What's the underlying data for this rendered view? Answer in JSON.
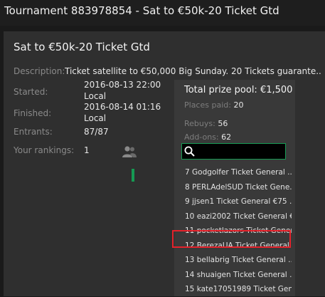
{
  "window": {
    "title": "Tournament 883978854 - Sat to €50k-20 Ticket Gtd"
  },
  "panel": {
    "title": "Sat to €50k-20 Ticket Gtd",
    "description_label": "Description:",
    "description_value": "Ticket satellite to €50,000 Big Sunday. 20 Tickets guarante...",
    "started_label": "Started:",
    "started_value_1": "2016-08-13 22:00",
    "started_value_2": "Local",
    "finished_label": "Finished:",
    "finished_value_1": "2016-08-14 01:16",
    "finished_value_2": "Local",
    "entrants_label": "Entrants:",
    "entrants_value": "87/87",
    "rankings_label": "Your rankings:",
    "rankings_value": "1"
  },
  "side": {
    "total_prize_label": "Total prize pool:",
    "total_prize_value": "€1,500",
    "places_label": "Places paid:",
    "places_value": "20",
    "rebuys_label": "Rebuys:",
    "rebuys_value": "56",
    "addons_label": "Add-ons:",
    "addons_value": "62",
    "search": {
      "value": "",
      "placeholder": ""
    },
    "icons": {
      "search": "magnifier-icon",
      "players": "players-icon"
    },
    "ranking_list": [
      "7 Godgolfer Ticket General ...",
      "8 PERLAdelSUD Ticket Gene...",
      "9 jjsen1 Ticket General €75 ...",
      "10 eazi2002 Ticket General €...",
      "11 pocketlazors Ticket Gener...",
      "12 BerezaUA Ticket General ...",
      "13 bellabrig Ticket General ...",
      "14 shuaigen Ticket General ...",
      "15 kate17051989 Ticket Gen..."
    ],
    "highlighted_row": "12 BerezaUA Ticket General ..."
  },
  "colors": {
    "accent": "#159a53",
    "highlight": "#e4222b",
    "background": "#1a1a1a",
    "panel": "#2f2f2f"
  }
}
